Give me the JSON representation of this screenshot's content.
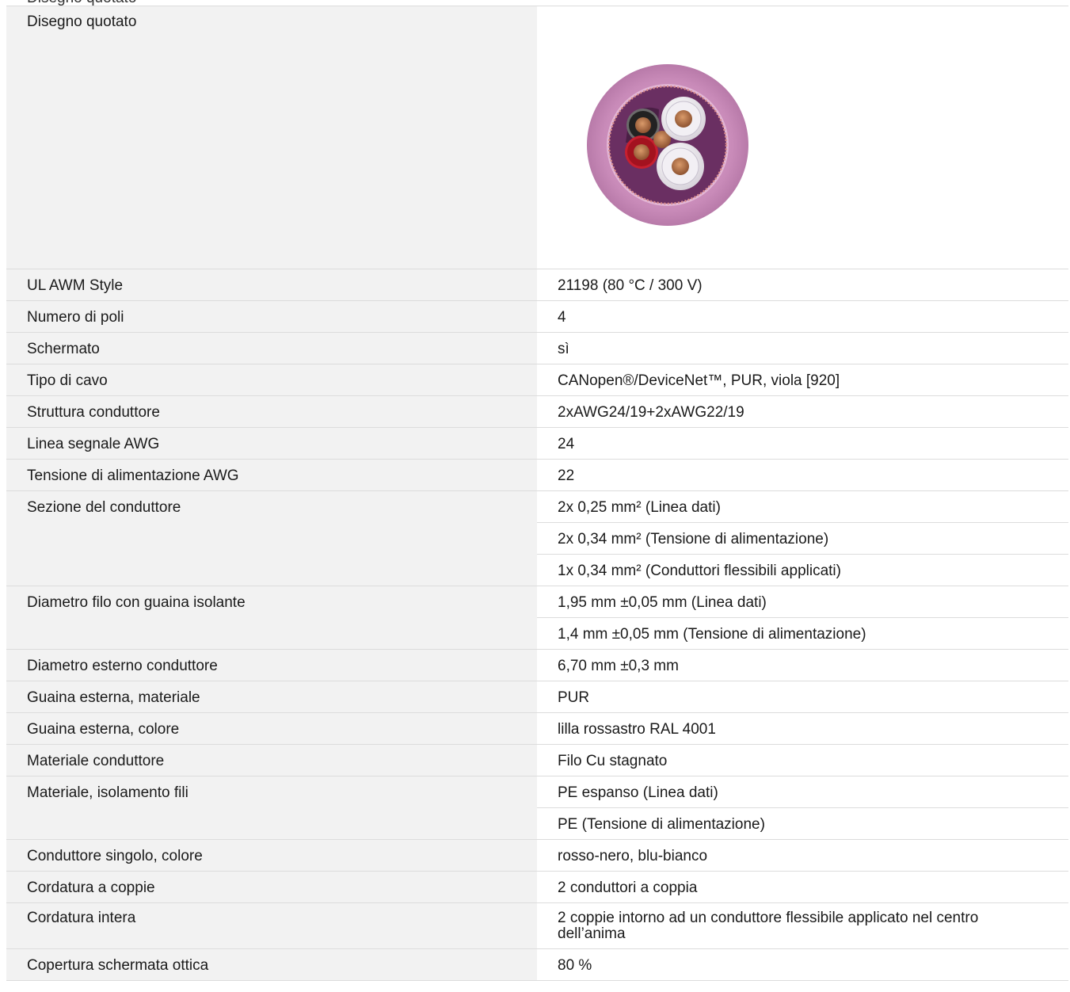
{
  "header_fragment": "Disegno quotato",
  "drawing": {
    "label": "Disegno quotato",
    "image_desc_icon": "cable-cross-section-icon"
  },
  "rows": [
    {
      "label": "UL AWM Style",
      "values": [
        "21198 (80 °C / 300 V)"
      ]
    },
    {
      "label": "Numero di poli",
      "values": [
        "4"
      ]
    },
    {
      "label": "Schermato",
      "values": [
        "sì"
      ]
    },
    {
      "label": "Tipo di cavo",
      "values": [
        "CANopen®/DeviceNet™, PUR, viola [920]"
      ]
    },
    {
      "label": "Struttura conduttore",
      "values": [
        "2xAWG24/19+2xAWG22/19"
      ]
    },
    {
      "label": "Linea segnale AWG",
      "values": [
        "24"
      ]
    },
    {
      "label": "Tensione di alimentazione AWG",
      "values": [
        "22"
      ]
    },
    {
      "label": "Sezione del conduttore",
      "values": [
        "2x 0,25 mm² (Linea dati)",
        "2x 0,34 mm² (Tensione di alimentazione)",
        "1x 0,34 mm² (Conduttori flessibili applicati)"
      ]
    },
    {
      "label": "Diametro filo con guaina isolante",
      "values": [
        "1,95 mm ±0,05 mm (Linea dati)",
        "1,4 mm ±0,05 mm (Tensione di alimentazione)"
      ]
    },
    {
      "label": "Diametro esterno conduttore",
      "values": [
        "6,70 mm ±0,3 mm"
      ]
    },
    {
      "label": "Guaina esterna, materiale",
      "values": [
        "PUR"
      ]
    },
    {
      "label": "Guaina esterna, colore",
      "values": [
        "lilla rossastro RAL 4001"
      ]
    },
    {
      "label": "Materiale conduttore",
      "values": [
        "Filo Cu stagnato"
      ]
    },
    {
      "label": "Materiale, isolamento fili",
      "values": [
        "PE espanso (Linea dati)",
        "PE (Tensione di alimentazione)"
      ]
    },
    {
      "label": "Conduttore singolo, colore",
      "values": [
        "rosso-nero, blu-bianco"
      ]
    },
    {
      "label": "Cordatura a coppie",
      "values": [
        "2 conduttori a coppia"
      ]
    },
    {
      "label": "Cordatura intera",
      "values": [
        "2 coppie intorno ad un conduttore flessibile applicato nel centro dell’anima"
      ],
      "tall": true
    },
    {
      "label": "Copertura schermata ottica",
      "values": [
        "80 %"
      ]
    }
  ],
  "colors": {
    "label_bg": "#f2f2f2",
    "border": "#dcdcdc",
    "sheath": "#c98bb9",
    "sheath_dark": "#b56aa3",
    "inner": "#5e2b5a",
    "copper": "#b87348"
  }
}
